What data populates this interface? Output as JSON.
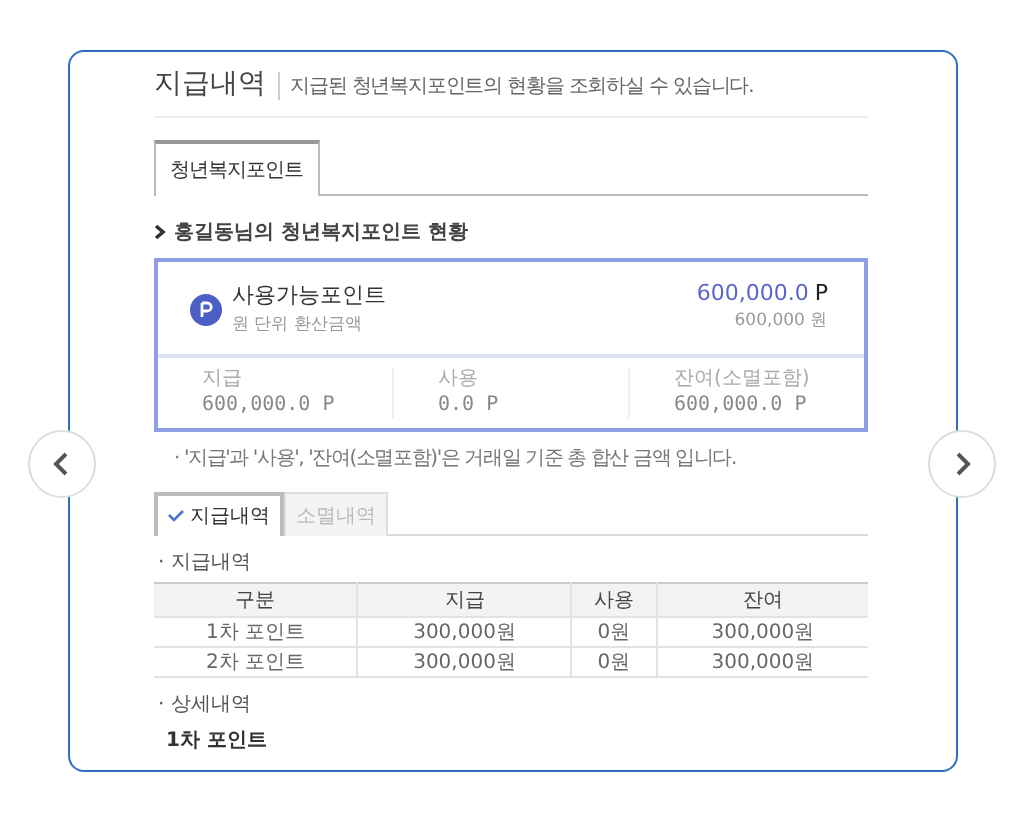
{
  "header": {
    "title": "지급내역",
    "subtitle": "지급된 청년복지포인트의 현황을 조회하실 수 있습니다."
  },
  "tabs": [
    {
      "label": "청년복지포인트",
      "selected": true
    }
  ],
  "status": {
    "heading": "홍길동님의 청년복지포인트 현황",
    "points": {
      "label": "사용가능포인트",
      "sublabel": "원 단위 환산금액",
      "value": "600,000.0",
      "unit": "P",
      "converted": "600,000 원"
    },
    "summary": [
      {
        "label": "지급",
        "value": "600,000.0 P"
      },
      {
        "label": "사용",
        "value": "0.0 P"
      },
      {
        "label": "잔여(소멸포함)",
        "value": "600,000.0 P"
      }
    ],
    "note": "· '지급'과 '사용', '잔여(소멸포함)'은 거래일 기준 총 합산 금액 입니다."
  },
  "sub_tabs": [
    {
      "label": "지급내역",
      "selected": true
    },
    {
      "label": "소멸내역",
      "selected": false
    }
  ],
  "payment_section": {
    "title": "· 지급내역",
    "columns": [
      "구분",
      "지급",
      "사용",
      "잔여"
    ],
    "rows": [
      [
        "1차 포인트",
        "300,000원",
        "0원",
        "300,000원"
      ],
      [
        "2차 포인트",
        "300,000원",
        "0원",
        "300,000원"
      ]
    ]
  },
  "detail_section": {
    "title": "· 상세내역",
    "items": [
      "1차 포인트"
    ]
  }
}
